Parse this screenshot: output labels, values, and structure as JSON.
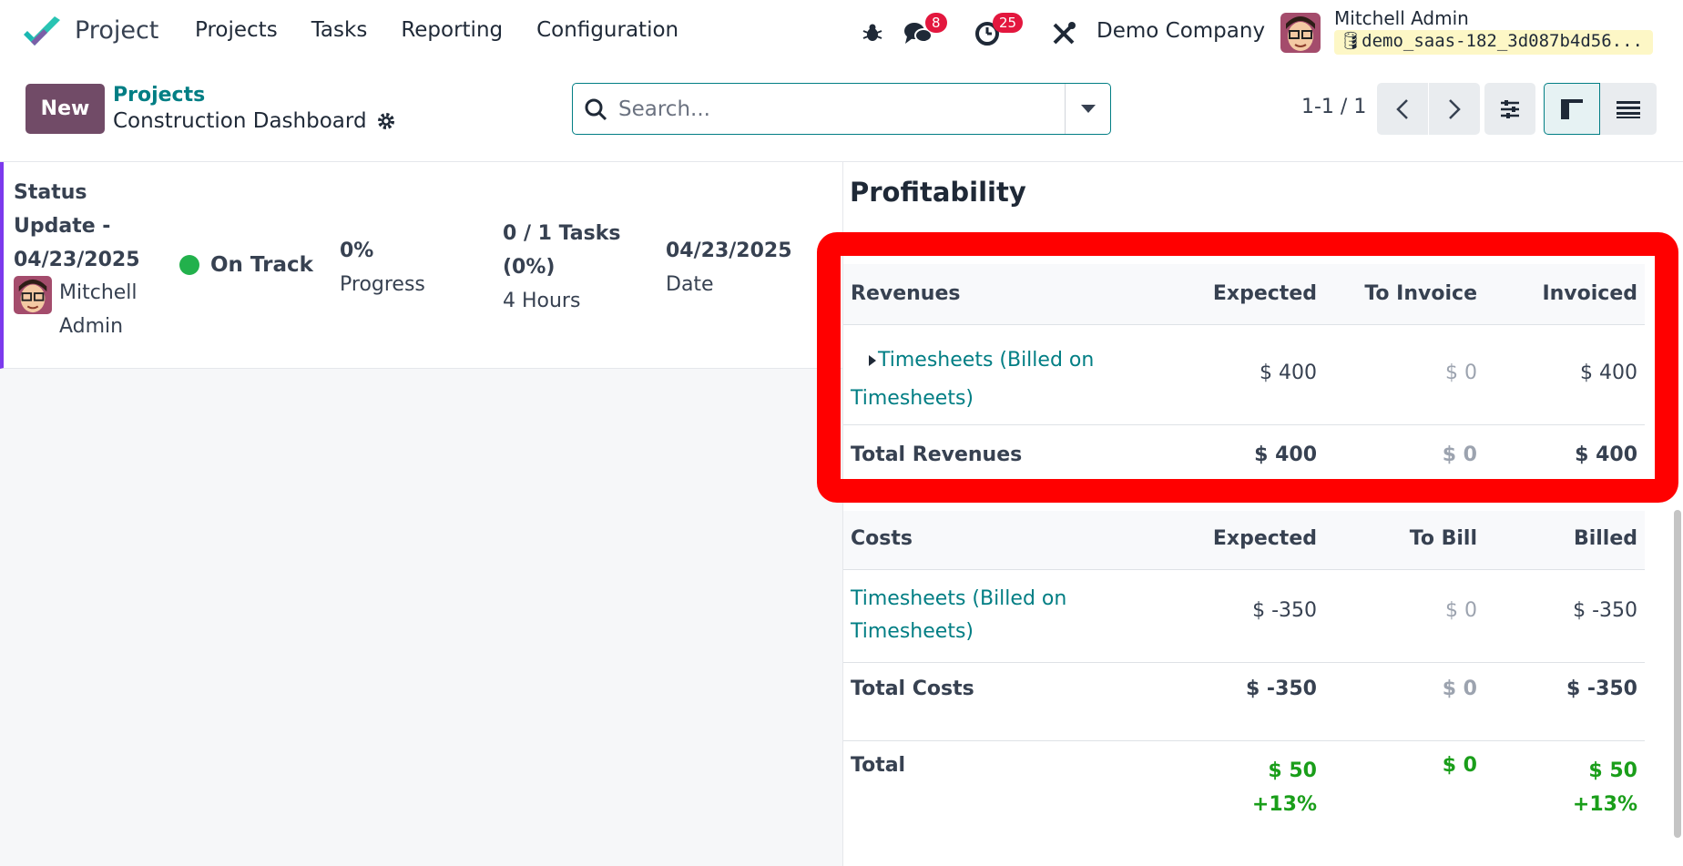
{
  "navbar": {
    "app_name": "Project",
    "menu": [
      "Projects",
      "Tasks",
      "Reporting",
      "Configuration"
    ],
    "messages_count": "8",
    "activities_count": "25",
    "company": "Demo Company",
    "user_name": "Mitchell Admin",
    "database": "demo_saas-182_3d087b4d56..."
  },
  "control_panel": {
    "new_label": "New",
    "breadcrumb_parent": "Projects",
    "breadcrumb_current": "Construction Dashboard",
    "search_placeholder": "Search...",
    "pager": "1-1 / 1"
  },
  "status_update": {
    "title": "Status Update - 04/23/2025",
    "author": "Mitchell Admin",
    "status": "On Track",
    "progress_value": "0%",
    "progress_label": "Progress",
    "tasks_value": "0 / 1 Tasks (0%)",
    "hours": "4 Hours",
    "date_value": "04/23/2025",
    "date_label": "Date"
  },
  "profitability": {
    "title": "Profitability",
    "revenues": {
      "headers": [
        "Revenues",
        "Expected",
        "To Invoice",
        "Invoiced"
      ],
      "row": {
        "label": "Timesheets (Billed on Timesheets)",
        "expected": "$ 400",
        "to_invoice": "$ 0",
        "invoiced": "$ 400"
      },
      "total": {
        "label": "Total Revenues",
        "expected": "$ 400",
        "to_invoice": "$ 0",
        "invoiced": "$ 400"
      }
    },
    "costs": {
      "headers": [
        "Costs",
        "Expected",
        "To Bill",
        "Billed"
      ],
      "row": {
        "label": "Timesheets (Billed on Timesheets)",
        "expected": "$ -350",
        "to_bill": "$ 0",
        "billed": "$ -350"
      },
      "total": {
        "label": "Total Costs",
        "expected": "$ -350",
        "to_bill": "$ 0",
        "billed": "$ -350"
      }
    },
    "total": {
      "label": "Total",
      "expected": "$ 50",
      "expected_pct": "+13%",
      "to_bill": "$ 0",
      "billed": "$ 50",
      "billed_pct": "+13%"
    }
  }
}
